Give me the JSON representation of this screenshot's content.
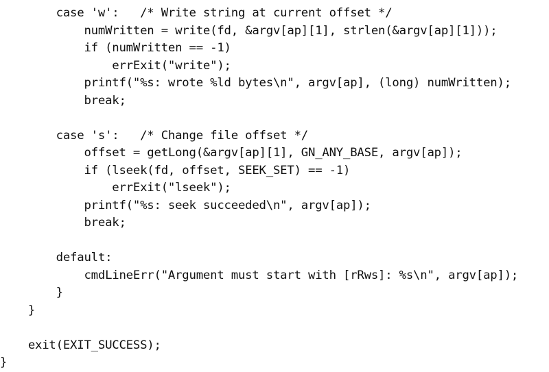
{
  "document": {
    "lines": [
      "        case 'w':   /* Write string at current offset */",
      "            numWritten = write(fd, &argv[ap][1], strlen(&argv[ap][1]));",
      "            if (numWritten == -1)",
      "                errExit(\"write\");",
      "            printf(\"%s: wrote %ld bytes\\n\", argv[ap], (long) numWritten);",
      "            break;",
      "",
      "        case 's':   /* Change file offset */",
      "            offset = getLong(&argv[ap][1], GN_ANY_BASE, argv[ap]);",
      "            if (lseek(fd, offset, SEEK_SET) == -1)",
      "                errExit(\"lseek\");",
      "            printf(\"%s: seek succeeded\\n\", argv[ap]);",
      "            break;",
      "",
      "        default:",
      "            cmdLineErr(\"Argument must start with [rRws]: %s\\n\", argv[ap]);",
      "        }",
      "    }",
      "",
      "    exit(EXIT_SUCCESS);",
      "}"
    ]
  }
}
